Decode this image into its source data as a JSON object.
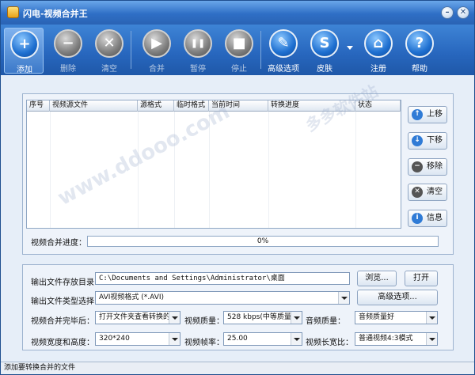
{
  "window": {
    "title": "闪电-视频合并王"
  },
  "colors": {
    "toolbar": "#2766bd",
    "accent_blue": "#1e6fd0",
    "disabled_gray": "#7d7d7d"
  },
  "toolbar": {
    "items": [
      {
        "label": "添加",
        "icon": "plus-icon",
        "symbol": "+",
        "enabled": true,
        "active": true
      },
      {
        "label": "删除",
        "icon": "minus-icon",
        "symbol": "−",
        "enabled": false
      },
      {
        "label": "清空",
        "icon": "x-icon",
        "symbol": "✕",
        "enabled": false
      },
      {
        "label": "合并",
        "icon": "play-icon",
        "symbol": "▶",
        "enabled": false
      },
      {
        "label": "暂停",
        "icon": "pause-icon",
        "symbol": "❚❚",
        "enabled": false
      },
      {
        "label": "停止",
        "icon": "stop-icon",
        "symbol": "■",
        "enabled": false
      },
      {
        "label": "高级选项",
        "icon": "tools-icon",
        "symbol": "✎",
        "enabled": true
      },
      {
        "label": "皮肤",
        "icon": "skin-icon",
        "symbol": "S",
        "enabled": true
      },
      {
        "label": "注册",
        "icon": "home-icon",
        "symbol": "⌂",
        "enabled": true
      },
      {
        "label": "帮助",
        "icon": "help-icon",
        "symbol": "?",
        "enabled": true
      }
    ]
  },
  "list": {
    "columns": [
      "序号",
      "视频源文件",
      "源格式",
      "临时格式",
      "当前时间",
      "转换进度",
      "状态"
    ]
  },
  "side_buttons": [
    {
      "label": "上移",
      "icon": "arrow-up-icon",
      "symbol": "↑"
    },
    {
      "label": "下移",
      "icon": "arrow-down-icon",
      "symbol": "↓"
    },
    {
      "label": "移除",
      "icon": "remove-icon",
      "symbol": "−"
    },
    {
      "label": "清空",
      "icon": "clear-icon",
      "symbol": "✕"
    },
    {
      "label": "信息",
      "icon": "info-icon",
      "symbol": "i"
    }
  ],
  "progress": {
    "label": "视频合并进度：",
    "value": 0,
    "text": "0%"
  },
  "settings": {
    "output_dir_label": "输出文件存放目录：",
    "output_dir_value": "C:\\Documents and Settings\\Administrator\\桌面",
    "browse_label": "浏览...",
    "open_label": "打开",
    "type_label": "输出文件类型选择：",
    "type_value": "AVI视频格式 (*.AVI)",
    "advanced_label": "高级选项...",
    "after_label": "视频合并完毕后：",
    "after_value": "打开文件夹查看转换的",
    "vquality_label": "视频质量：",
    "vquality_value": "528 kbps(中等质量)",
    "aquality_label": "音频质量：",
    "aquality_value": "音频质量好",
    "size_label": "视频宽度和高度：",
    "size_value": "320*240",
    "fps_label": "视频帧率：",
    "fps_value": "25.00",
    "aspect_label": "视频长宽比：",
    "aspect_value": "普通视频4:3模式"
  },
  "status": {
    "text": "添加要转换合并的文件"
  },
  "watermark": {
    "text": "www.ddooo.com",
    "cn": "多多软件站"
  }
}
